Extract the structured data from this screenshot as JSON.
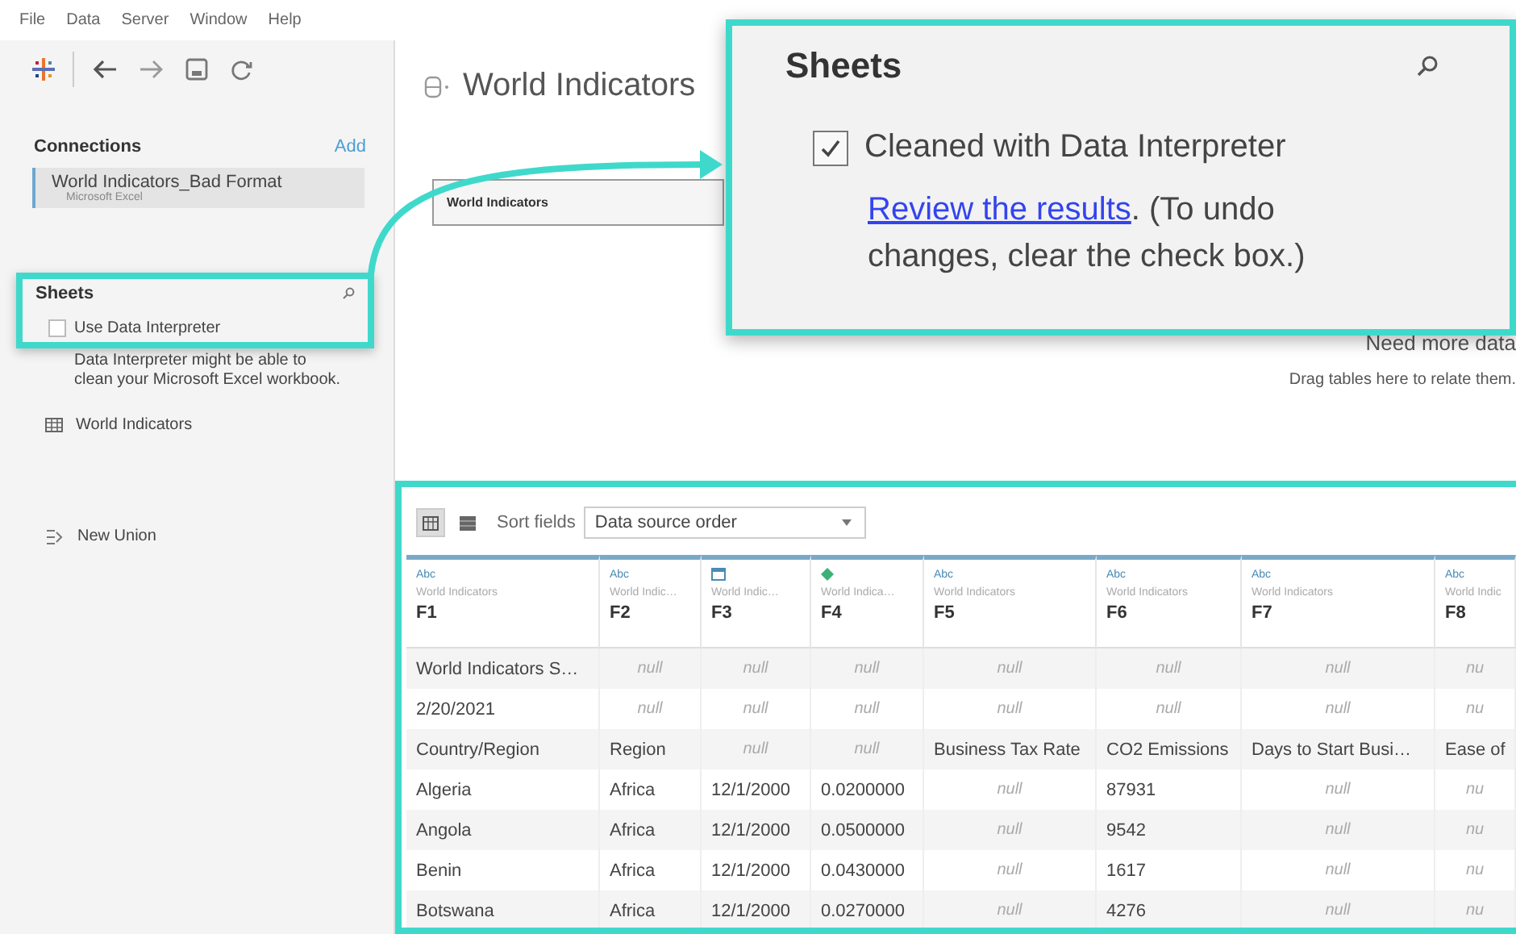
{
  "menu": [
    "File",
    "Data",
    "Server",
    "Window",
    "Help"
  ],
  "connections": {
    "title": "Connections",
    "add": "Add",
    "items": [
      {
        "name": "World Indicators_Bad Format",
        "type": "Microsoft Excel",
        "selected": true
      }
    ]
  },
  "sheets": {
    "title": "Sheets",
    "interpreter": {
      "label": "Use Data Interpreter",
      "checked": false
    },
    "hint": "Data Interpreter might be able to clean your Microsoft Excel workbook.",
    "items": [
      {
        "name": "World Indicators"
      }
    ],
    "new_union": "New Union"
  },
  "canvas": {
    "title": "World Indicators",
    "table": "World Indicators",
    "empty_title": "Need more data",
    "empty_hint": "Drag tables here to relate them."
  },
  "callout": {
    "title": "Sheets",
    "interpreter": {
      "label": "Cleaned with Data Interpreter",
      "checked": true
    },
    "link": "Review the results",
    "note": ". (To undo changes, clear the check box.)"
  },
  "grid": {
    "views": [
      {
        "kind": "grid",
        "selected": true
      },
      {
        "kind": "list",
        "selected": false
      }
    ],
    "sort_label": "Sort fields",
    "sort_value": "Data source order",
    "columns": [
      {
        "kind": "text",
        "type_label": "Abc",
        "source": "World Indicators",
        "name": "F1"
      },
      {
        "kind": "text",
        "type_label": "Abc",
        "source": "World Indic…",
        "name": "F2"
      },
      {
        "kind": "date",
        "source": "World Indic…",
        "name": "F3"
      },
      {
        "kind": "number",
        "source": "World Indica…",
        "name": "F4"
      },
      {
        "kind": "text",
        "type_label": "Abc",
        "source": "World Indicators",
        "name": "F5"
      },
      {
        "kind": "text",
        "type_label": "Abc",
        "source": "World Indicators",
        "name": "F6"
      },
      {
        "kind": "text",
        "type_label": "Abc",
        "source": "World Indicators",
        "name": "F7"
      },
      {
        "kind": "text",
        "type_label": "Abc",
        "source": "World Indic",
        "name": "F8"
      }
    ],
    "rows": [
      [
        {
          "text": "World Indicators S…",
          "is_null": false
        },
        {
          "text": "null",
          "is_null": true
        },
        {
          "text": "null",
          "is_null": true
        },
        {
          "text": "null",
          "is_null": true
        },
        {
          "text": "null",
          "is_null": true
        },
        {
          "text": "null",
          "is_null": true
        },
        {
          "text": "null",
          "is_null": true
        },
        {
          "text": "nu",
          "is_null": true
        }
      ],
      [
        {
          "text": "2/20/2021",
          "is_null": false
        },
        {
          "text": "null",
          "is_null": true
        },
        {
          "text": "null",
          "is_null": true
        },
        {
          "text": "null",
          "is_null": true
        },
        {
          "text": "null",
          "is_null": true
        },
        {
          "text": "null",
          "is_null": true
        },
        {
          "text": "null",
          "is_null": true
        },
        {
          "text": "nu",
          "is_null": true
        }
      ],
      [
        {
          "text": "Country/Region",
          "is_null": false
        },
        {
          "text": "Region",
          "is_null": false
        },
        {
          "text": "null",
          "is_null": true
        },
        {
          "text": "null",
          "is_null": true
        },
        {
          "text": "Business Tax Rate",
          "is_null": false
        },
        {
          "text": "CO2 Emissions",
          "is_null": false
        },
        {
          "text": "Days to Start Busi…",
          "is_null": false
        },
        {
          "text": "Ease of",
          "is_null": false
        }
      ],
      [
        {
          "text": "Algeria",
          "is_null": false
        },
        {
          "text": "Africa",
          "is_null": false
        },
        {
          "text": "12/1/2000",
          "is_null": false
        },
        {
          "text": "0.0200000",
          "is_null": false
        },
        {
          "text": "null",
          "is_null": true
        },
        {
          "text": "87931",
          "is_null": false
        },
        {
          "text": "null",
          "is_null": true
        },
        {
          "text": "nu",
          "is_null": true
        }
      ],
      [
        {
          "text": "Angola",
          "is_null": false
        },
        {
          "text": "Africa",
          "is_null": false
        },
        {
          "text": "12/1/2000",
          "is_null": false
        },
        {
          "text": "0.0500000",
          "is_null": false
        },
        {
          "text": "null",
          "is_null": true
        },
        {
          "text": "9542",
          "is_null": false
        },
        {
          "text": "null",
          "is_null": true
        },
        {
          "text": "nu",
          "is_null": true
        }
      ],
      [
        {
          "text": "Benin",
          "is_null": false
        },
        {
          "text": "Africa",
          "is_null": false
        },
        {
          "text": "12/1/2000",
          "is_null": false
        },
        {
          "text": "0.0430000",
          "is_null": false
        },
        {
          "text": "null",
          "is_null": true
        },
        {
          "text": "1617",
          "is_null": false
        },
        {
          "text": "null",
          "is_null": true
        },
        {
          "text": "nu",
          "is_null": true
        }
      ],
      [
        {
          "text": "Botswana",
          "is_null": false
        },
        {
          "text": "Africa",
          "is_null": false
        },
        {
          "text": "12/1/2000",
          "is_null": false
        },
        {
          "text": "0.0270000",
          "is_null": false
        },
        {
          "text": "null",
          "is_null": true
        },
        {
          "text": "4276",
          "is_null": false
        },
        {
          "text": "null",
          "is_null": true
        },
        {
          "text": "nu",
          "is_null": true
        }
      ]
    ]
  }
}
